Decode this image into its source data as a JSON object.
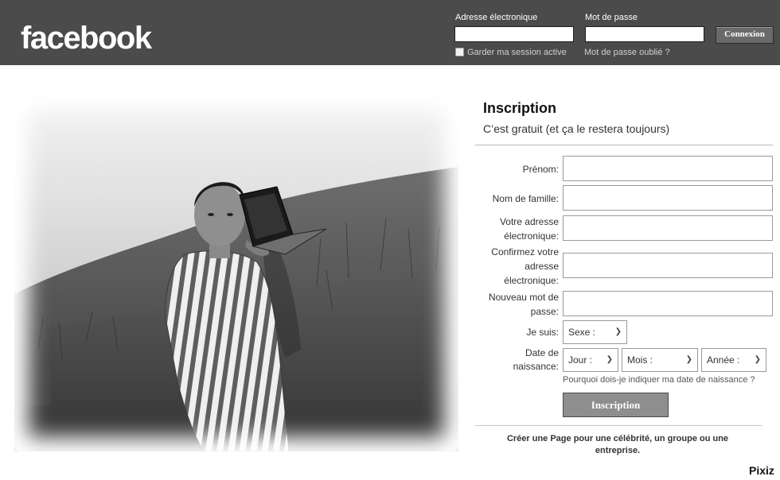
{
  "header": {
    "logo": "facebook",
    "email_label": "Adresse électronique",
    "password_label": "Mot de passe",
    "login_button": "Connexion",
    "remember_label": "Garder ma session active",
    "forgot_link": "Mot de passe oublié ?"
  },
  "signup": {
    "title": "Inscription",
    "subtitle": "C’est gratuit (et ça le restera toujours)",
    "labels": {
      "first_name": "Prénom:",
      "last_name": "Nom de famille:",
      "email_1": "Votre adresse",
      "email_2": "électronique:",
      "confirm_1": "Confirmez votre",
      "confirm_2": "adresse",
      "confirm_3": "électronique:",
      "password_1": "Nouveau mot de",
      "password_2": "passe:",
      "gender": "Je suis:",
      "birth_1": "Date de",
      "birth_2": "naissance:"
    },
    "gender_select": "Sexe :",
    "day_select": "Jour :",
    "month_select": "Mois :",
    "year_select": "Année :",
    "why_link": "Pourquoi dois-je indiquer ma date de naissance ?",
    "submit": "Inscription",
    "create_page_bold": "Créer une Page",
    "create_page_rest": "pour une célébrité, un groupe ou une entreprise."
  },
  "watermark": "Pixiz"
}
